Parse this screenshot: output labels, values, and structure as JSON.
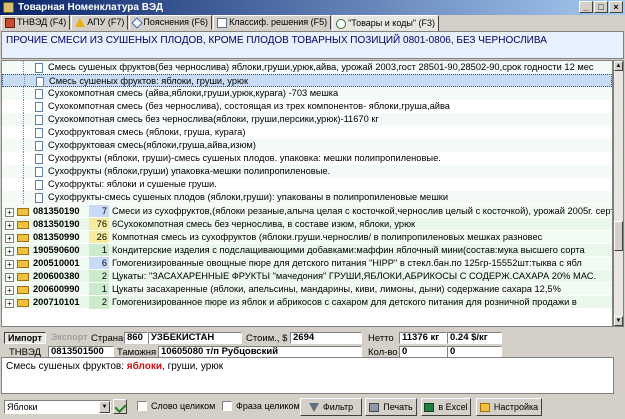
{
  "window": {
    "title": "Товарная Номенклатура ВЭД"
  },
  "tabs": [
    {
      "label": "ТНВЭД (F4)",
      "icon": "book-icon"
    },
    {
      "label": "АПУ (F7)",
      "icon": "warning-icon"
    },
    {
      "label": "Пояснения (F6)",
      "icon": "diamond-icon"
    },
    {
      "label": "Классиф. решения (F5)",
      "icon": "page-icon"
    },
    {
      "label": "\"Товары и коды\" (F3)",
      "icon": "circle-icon"
    }
  ],
  "heading": "ПРОЧИЕ СМЕСИ ИЗ СУШЕНЫХ ПЛОДОВ, КРОМЕ ПЛОДОВ ТОВАРНЫХ ПОЗИЦИЙ 0801-0806, БЕЗ ЧЕРНОСЛИВА",
  "tree": {
    "children": [
      "Смесь сушеных фруктов(без чернослива) яблоки,груши,урюк,айва, урожай 2003,гост 28501-90,28502-90,срок годности 12 мес",
      "Смесь сушеных фруктов: яблоки, груши, урюк",
      "Сухокомпотная смесь (айва,яблоки,груши,урюк,курага) -703 мешка",
      "Сухокомпотная смесь (без чернослива), состоящая из трех компонентов- яблоки,груша,айва",
      "Сухокомпотная смесь без чернослива(яблоки, груши,персики,урюк)-11670 кг",
      "Сухофруктовая смесь (яблоки, груша, курага)",
      "Сухофруктовая смесь(яблоки,груша,айва,изюм)",
      "Сухофрукты (яблоки, груши)-смесь сушеных плодов. упаковка: мешки полипропиленовые.",
      "Сухофрукты (яблоки,груши) упаковка-мешки полипропиленовые.",
      "Сухофрукты: яблоки и сушеные груши.",
      "Сухофрукты-смесь сушеных плодов (яблоки,груши): упакованы в полипропиленовые мешки"
    ],
    "parents": [
      {
        "code": "081350190",
        "count": "7",
        "color": "blue",
        "text": "Смеси из сухофруктов,(яблоки резаные,алыча целая с косточкой,чернослив целый с косточкой), урожай 2005г. сертиф"
      },
      {
        "code": "081350190",
        "count": "76",
        "color": "yellow",
        "text": "6Сухокомпотная смесь без чернослива, в составе изюм, яблоки, урюк"
      },
      {
        "code": "081350990",
        "count": "26",
        "color": "yellow",
        "text": "Компотная смесь из сухофруктов (яблоки.груши.чернослив/ в полипропиленовых мешках разновес"
      },
      {
        "code": "190590600",
        "count": "1",
        "color": "green",
        "text": "Кондитерские изделия с подслащивающими добавками:маффин яблочный мини(состав:мука высшего сорта"
      },
      {
        "code": "200510001",
        "count": "6",
        "color": "blue",
        "text": "Гомогенизированные овощные пюре для детского питания \"HIPP\" в стекл.бан.по 125гр-15552шт:тыква с ябл"
      },
      {
        "code": "200600380",
        "count": "2",
        "color": "green",
        "text": "Цукаты: \"ЗАСАХАРЕННЫЕ ФРУКТЫ \"мачедония\" ГРУШИ,ЯБЛОКИ,АБРИКОСЫ С СОДЕРЖ.САХАРА 20% МАС."
      },
      {
        "code": "200600990",
        "count": "1",
        "color": "green",
        "text": "Цукаты засахаренные (яблоки, апельсины, мандарины, киви, лимоны, дыни) содержание сахара 12,5%"
      },
      {
        "code": "200710101",
        "count": "2",
        "color": "green",
        "text": "Гомогенизированное пюре из яблок и абрикосов с сахаром для детского питания для розничной продажи в"
      }
    ]
  },
  "info": {
    "import_label": "Импорт",
    "export_label": "Экспорт",
    "country_label": "Страна",
    "country_code": "860",
    "country_name": "УЗБЕКИСТАН",
    "cost_label": "Стоим., $",
    "cost_value": "2694",
    "net_label": "Нетто",
    "net_value": "11376 кг",
    "price_value": "0.24 $/кг",
    "tnved_label": "ТНВЭД",
    "tnved_value": "0813501500",
    "customs_label": "Таможня",
    "customs_value": "10605080 т/п Рубцовский",
    "qty_label": "Кол-во",
    "qty_value": "0",
    "qty_value2": "0"
  },
  "description": {
    "prefix": "Смесь сушеных фруктов: ",
    "highlight": "яблоки",
    "suffix": ", груши, урюк"
  },
  "bottom": {
    "search_value": "Яблоки",
    "whole_word_label": "Слово целиком",
    "whole_phrase_label": "Фраза целиком",
    "filter_label": "Фильтр",
    "print_label": "Печать",
    "excel_label": "в Excel",
    "settings_label": "Настройка"
  }
}
